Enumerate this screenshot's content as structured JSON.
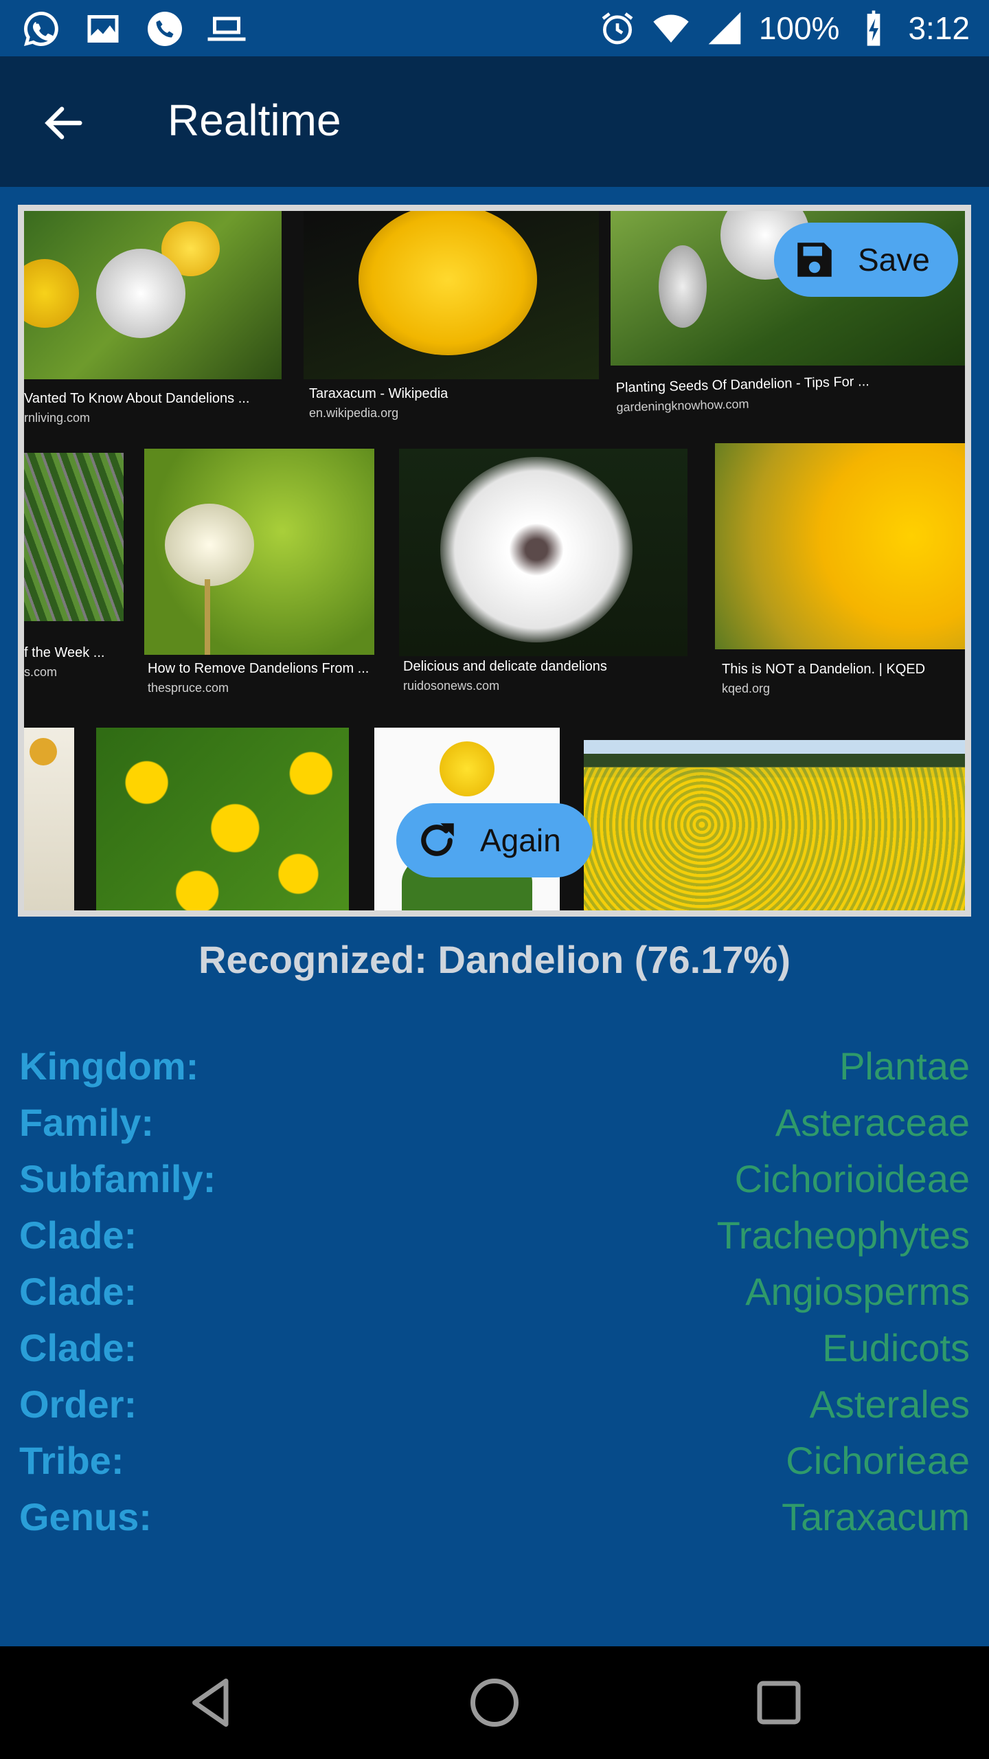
{
  "status_bar": {
    "battery": "100%",
    "time": "3:12",
    "left_icons": [
      "whatsapp-icon",
      "image-icon",
      "phone-icon",
      "laptop-icon"
    ],
    "right_icons": [
      "alarm-icon",
      "wifi-icon",
      "signal-icon",
      "battery-charging-icon"
    ]
  },
  "app_bar": {
    "title": "Realtime",
    "back_icon": "arrow-left-icon"
  },
  "image": {
    "captions": [
      {
        "title": "Vanted To Know About Dandelions ...",
        "site": "rnliving.com"
      },
      {
        "title": "Taraxacum - Wikipedia",
        "site": "en.wikipedia.org"
      },
      {
        "title": "Planting Seeds Of Dandelion - Tips For ...",
        "site": "gardeningknowhow.com"
      },
      {
        "title": "f the Week ...",
        "site": "s.com"
      },
      {
        "title": "How to Remove Dandelions From ...",
        "site": "thespruce.com"
      },
      {
        "title": "Delicious and delicate dandelions",
        "site": "ruidosonews.com"
      },
      {
        "title": "This is NOT a Dandelion. | KQED",
        "site": "kqed.org"
      }
    ]
  },
  "buttons": {
    "save": {
      "label": "Save",
      "icon": "save-icon"
    },
    "again": {
      "label": "Again",
      "icon": "refresh-icon"
    }
  },
  "result": {
    "recognized": "Recognized: Dandelion (76.17%)"
  },
  "taxonomy": [
    {
      "label": "Kingdom:",
      "value": "Plantae"
    },
    {
      "label": "Family:",
      "value": "Asteraceae"
    },
    {
      "label": "Subfamily:",
      "value": "Cichorioideae"
    },
    {
      "label": "Clade:",
      "value": "Tracheophytes"
    },
    {
      "label": "Clade:",
      "value": "Angiosperms"
    },
    {
      "label": "Clade:",
      "value": "Eudicots"
    },
    {
      "label": "Order:",
      "value": "Asterales"
    },
    {
      "label": "Tribe:",
      "value": "Cichorieae"
    },
    {
      "label": "Genus:",
      "value": "Taraxacum"
    }
  ],
  "colors": {
    "background": "#064b8a",
    "app_bar": "#052a4f",
    "button": "#4fa6f0",
    "label": "#2a9ed8",
    "value": "#2f9a6b",
    "recognized_text": "#cfd5dc"
  },
  "nav_bar": {
    "icons": [
      "nav-back-icon",
      "nav-home-icon",
      "nav-recents-icon"
    ]
  }
}
